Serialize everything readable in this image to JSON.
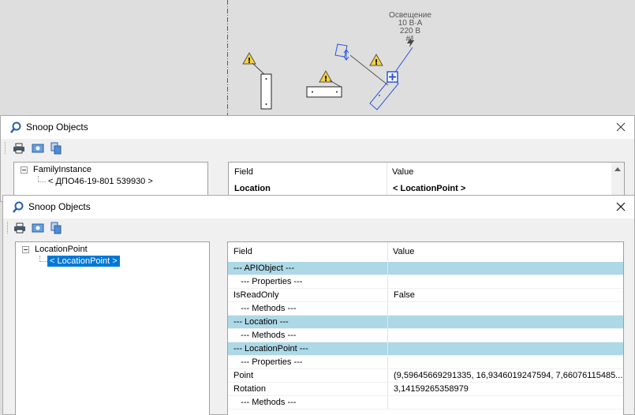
{
  "canvas": {
    "tag_lines": [
      "Освещение",
      "10 В·А",
      "220 В",
      "#1"
    ]
  },
  "window_back": {
    "title": "Snoop Objects",
    "tree": {
      "root": "FamilyInstance",
      "child": "< ДПО46-19-801  539930 >"
    },
    "grid": {
      "headers": [
        "Field",
        "Value"
      ],
      "rows": [
        {
          "field": "Location",
          "value": "< LocationPoint >",
          "bold": true
        }
      ]
    }
  },
  "window_front": {
    "title": "Snoop Objects",
    "tree": {
      "root": "LocationPoint",
      "child": "< LocationPoint >"
    },
    "grid": {
      "headers": [
        "Field",
        "Value"
      ],
      "rows": [
        {
          "field": "--- APIObject ---",
          "value": "",
          "section": true
        },
        {
          "field": "   --- Properties ---",
          "value": ""
        },
        {
          "field": "IsReadOnly",
          "value": "False"
        },
        {
          "field": "   --- Methods ---",
          "value": ""
        },
        {
          "field": "--- Location ---",
          "value": "",
          "section": true
        },
        {
          "field": "   --- Methods ---",
          "value": ""
        },
        {
          "field": "--- LocationPoint ---",
          "value": "",
          "section": true
        },
        {
          "field": "   --- Properties ---",
          "value": ""
        },
        {
          "field": "Point",
          "value": "(9,59645669291335, 16,9346019247594, 7,66076115485..."
        },
        {
          "field": "Rotation",
          "value": "3,14159265358979"
        },
        {
          "field": "   --- Methods ---",
          "value": ""
        }
      ]
    }
  },
  "toolbar_icons": [
    "print-icon",
    "snapshot-icon",
    "copy-icon"
  ],
  "colors": {
    "section_row": "#add8e6",
    "selection": "#0078d7",
    "warning_yellow": "#f5d33a",
    "annotation_blue": "#2b56d8"
  }
}
